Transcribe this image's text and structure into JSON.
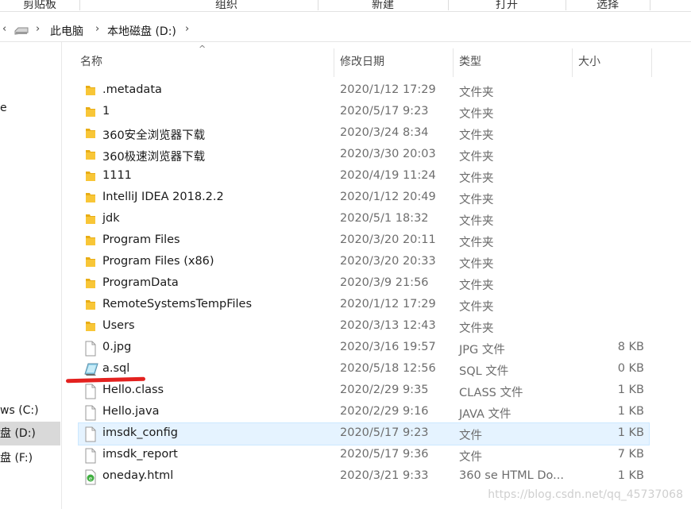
{
  "ribbon": {
    "groups": [
      "剪贴板",
      "组织",
      "新建",
      "打开",
      "选择"
    ]
  },
  "address": {
    "separator": "›",
    "crumbs": [
      "此电脑",
      "本地磁盘 (D:)"
    ]
  },
  "nav": {
    "items": [
      {
        "label": "e",
        "selected": false
      },
      {
        "label": "ws (C:)",
        "selected": false
      },
      {
        "label": "盘 (D:)",
        "selected": true
      },
      {
        "label": "盘 (F:)",
        "selected": false
      }
    ]
  },
  "columns": {
    "name": "名称",
    "date": "修改日期",
    "type": "类型",
    "size": "大小",
    "sort_indicator": "^"
  },
  "files": [
    {
      "name": ".metadata",
      "date": "2020/1/12 17:29",
      "type": "文件夹",
      "size": "",
      "icon": "folder-icon"
    },
    {
      "name": "1",
      "date": "2020/5/17 9:23",
      "type": "文件夹",
      "size": "",
      "icon": "folder-icon"
    },
    {
      "name": "360安全浏览器下载",
      "date": "2020/3/24 8:34",
      "type": "文件夹",
      "size": "",
      "icon": "folder-icon"
    },
    {
      "name": "360极速浏览器下载",
      "date": "2020/3/30 20:03",
      "type": "文件夹",
      "size": "",
      "icon": "folder-icon"
    },
    {
      "name": "1111",
      "date": "2020/4/19 11:24",
      "type": "文件夹",
      "size": "",
      "icon": "folder-icon"
    },
    {
      "name": "IntelliJ IDEA 2018.2.2",
      "date": "2020/1/12 20:49",
      "type": "文件夹",
      "size": "",
      "icon": "folder-icon"
    },
    {
      "name": "jdk",
      "date": "2020/5/1 18:32",
      "type": "文件夹",
      "size": "",
      "icon": "folder-icon"
    },
    {
      "name": "Program Files",
      "date": "2020/3/20 20:11",
      "type": "文件夹",
      "size": "",
      "icon": "folder-icon"
    },
    {
      "name": "Program Files (x86)",
      "date": "2020/3/20 20:33",
      "type": "文件夹",
      "size": "",
      "icon": "folder-icon"
    },
    {
      "name": "ProgramData",
      "date": "2020/3/9 21:56",
      "type": "文件夹",
      "size": "",
      "icon": "folder-icon"
    },
    {
      "name": "RemoteSystemsTempFiles",
      "date": "2020/1/12 17:29",
      "type": "文件夹",
      "size": "",
      "icon": "folder-icon"
    },
    {
      "name": "Users",
      "date": "2020/3/13 12:43",
      "type": "文件夹",
      "size": "",
      "icon": "folder-icon"
    },
    {
      "name": "0.jpg",
      "date": "2020/3/16 19:57",
      "type": "JPG 文件",
      "size": "8 KB",
      "icon": "file-icon"
    },
    {
      "name": "a.sql",
      "date": "2020/5/18 12:56",
      "type": "SQL 文件",
      "size": "0 KB",
      "icon": "sql-file-icon"
    },
    {
      "name": "Hello.class",
      "date": "2020/2/29 9:35",
      "type": "CLASS 文件",
      "size": "1 KB",
      "icon": "file-icon"
    },
    {
      "name": "Hello.java",
      "date": "2020/2/29 9:16",
      "type": "JAVA 文件",
      "size": "1 KB",
      "icon": "file-icon"
    },
    {
      "name": "imsdk_config",
      "date": "2020/5/17 9:23",
      "type": "文件",
      "size": "1 KB",
      "icon": "file-icon",
      "hover": true
    },
    {
      "name": "imsdk_report",
      "date": "2020/5/17 9:36",
      "type": "文件",
      "size": "7 KB",
      "icon": "file-icon"
    },
    {
      "name": "oneday.html",
      "date": "2020/3/21 9:33",
      "type": "360 se HTML Do...",
      "size": "1 KB",
      "icon": "html-file-icon"
    }
  ],
  "watermark": "https://blog.csdn.net/qq_45737068",
  "colors": {
    "folder": "#f8c637",
    "folder_dark": "#e8ad16",
    "hover_bg": "#e5f3ff",
    "annotation": "#e3211f"
  }
}
